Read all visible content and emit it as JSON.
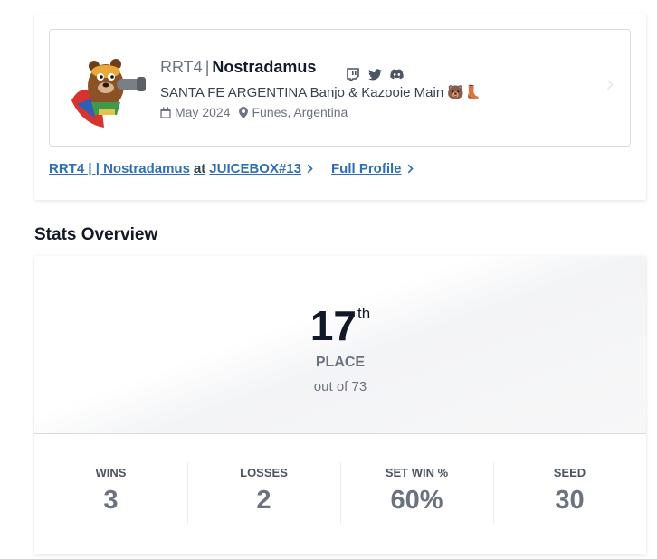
{
  "profile": {
    "prefix": "RRT4",
    "separator": "|",
    "gamertag": "Nostradamus",
    "bio": "SANTA FE ARGENTINA Banjo & Kazooie Main 🐻👢",
    "joined": "May 2024",
    "location": "Funes, Argentina",
    "social_icons": [
      "twitch-icon",
      "twitter-icon",
      "discord-icon"
    ]
  },
  "links": {
    "entrant": "RRT4 | | Nostradamus",
    "at": "at",
    "event": "JUICEBOX#13",
    "full_profile": "Full Profile"
  },
  "stats_overview": {
    "title": "Stats Overview",
    "placement": "17",
    "placement_suffix": "th",
    "placement_label": "PLACE",
    "out_of": "out of 73",
    "stats": [
      {
        "label": "WINS",
        "value": "3"
      },
      {
        "label": "LOSSES",
        "value": "2"
      },
      {
        "label": "SET WIN %",
        "value": "60%"
      },
      {
        "label": "SEED",
        "value": "30"
      }
    ]
  },
  "colors": {
    "link": "#2f6fb3",
    "muted": "#6b7280",
    "heading": "#111827"
  }
}
